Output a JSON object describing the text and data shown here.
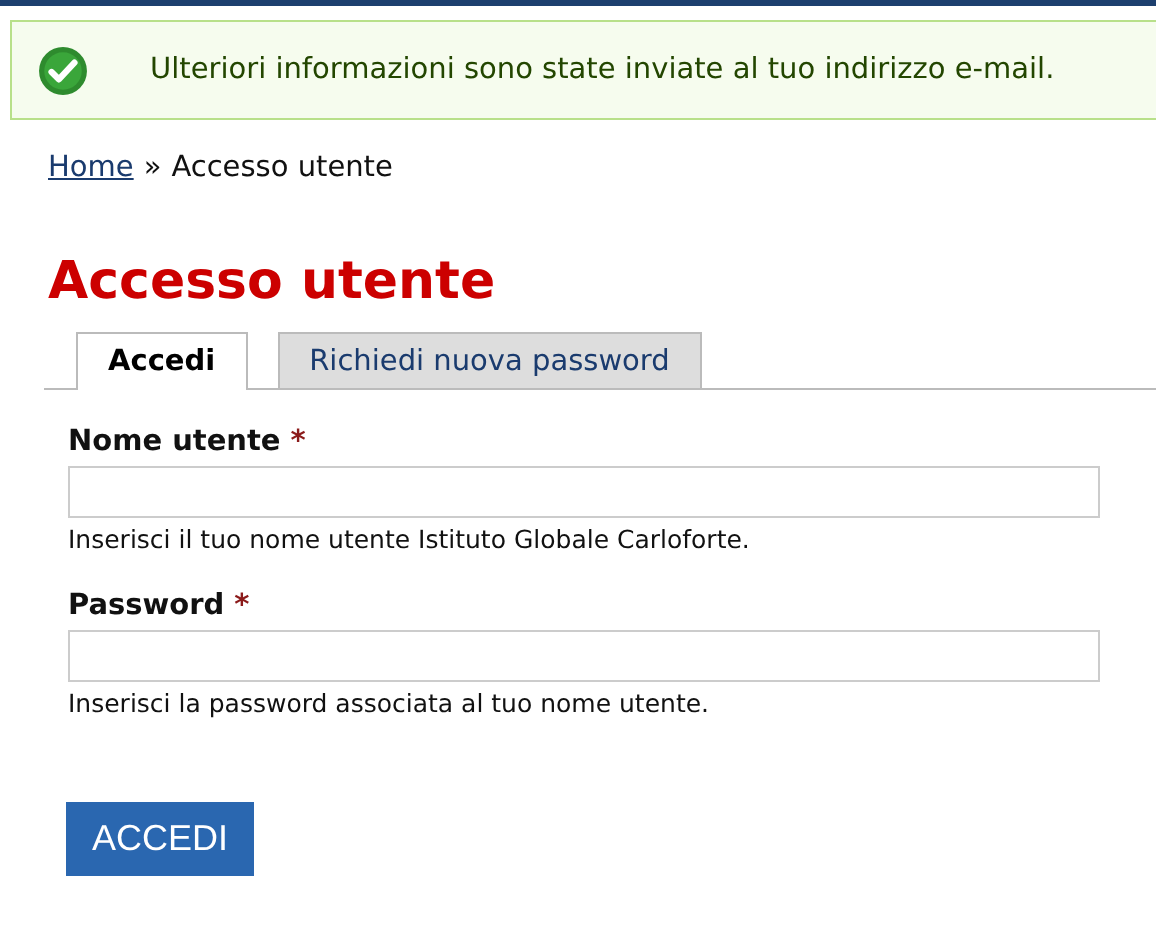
{
  "message": {
    "kind": "status",
    "text": "Ulteriori informazioni sono state inviate al tuo indirizzo e-mail."
  },
  "breadcrumb": {
    "links": [
      "Home"
    ],
    "separator": "»",
    "current": "Accesso utente"
  },
  "title": "Accesso utente",
  "tabs": [
    {
      "label": "Accedi",
      "selected": true
    },
    {
      "label": "Richiedi nuova password",
      "selected": false
    }
  ],
  "fields": [
    {
      "label": "Nome utente",
      "required_mark": "*",
      "description": "Inserisci il tuo nome utente Istituto Globale Carloforte."
    },
    {
      "label": "Password",
      "required_mark": "*",
      "description": "Inserisci la password associata al tuo nome utente."
    }
  ],
  "submit": "ACCEDI"
}
